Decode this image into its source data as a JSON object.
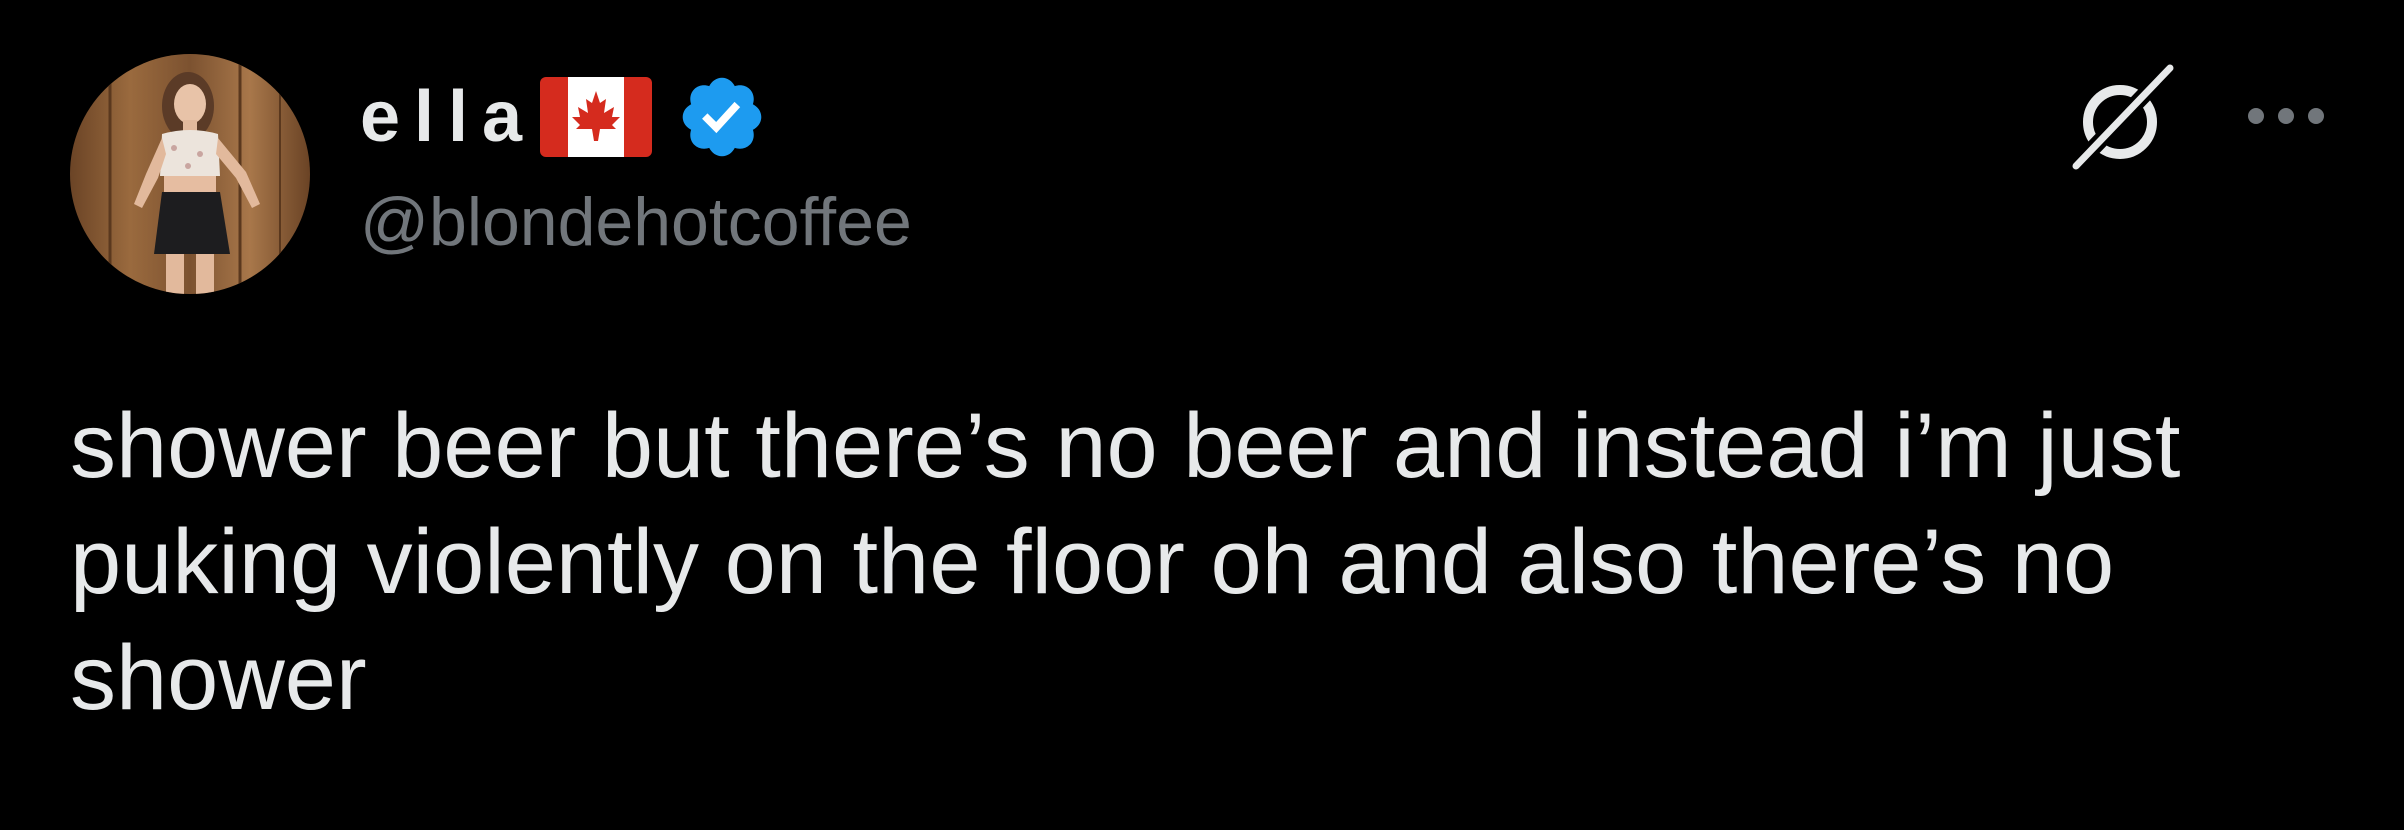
{
  "tweet": {
    "author": {
      "display_name": "ella",
      "handle": "@blondehotcoffee",
      "flag_icon": "canada-flag-icon",
      "verified_icon": "verified-badge-icon"
    },
    "actions": {
      "grok_icon": "grok-icon",
      "more_icon": "more-dots-icon"
    },
    "text": "shower beer but there’s no beer and instead i’m just puking violently on the floor oh and also there’s no shower"
  },
  "colors": {
    "background": "#000000",
    "text_primary": "#e7e9ea",
    "text_secondary": "#71767b",
    "verified_blue": "#1d9bf0",
    "flag_red": "#d52b1e"
  }
}
